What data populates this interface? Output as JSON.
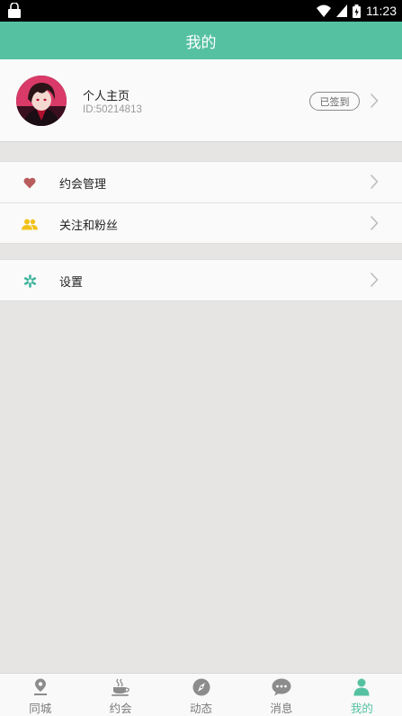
{
  "status_bar": {
    "time": "11:23"
  },
  "header": {
    "title": "我的"
  },
  "profile": {
    "name": "个人主页",
    "id": "ID:50214813",
    "sign_badge": "已签到"
  },
  "menu_groups": [
    [
      {
        "label": "约会管理",
        "icon": "heart-icon"
      },
      {
        "label": "关注和粉丝",
        "icon": "users-icon"
      }
    ],
    [
      {
        "label": "设置",
        "icon": "gear-icon"
      }
    ]
  ],
  "tabs": [
    {
      "label": "同城",
      "icon": "location-pin-icon"
    },
    {
      "label": "约会",
      "icon": "coffee-cup-icon"
    },
    {
      "label": "动态",
      "icon": "compass-icon"
    },
    {
      "label": "消息",
      "icon": "chat-bubble-icon"
    },
    {
      "label": "我的",
      "icon": "person-icon",
      "active": true
    }
  ],
  "colors": {
    "accent": "#56c1a1",
    "heart": "#b85c5c",
    "users": "#f2c21b",
    "background": "#e6e5e3"
  }
}
